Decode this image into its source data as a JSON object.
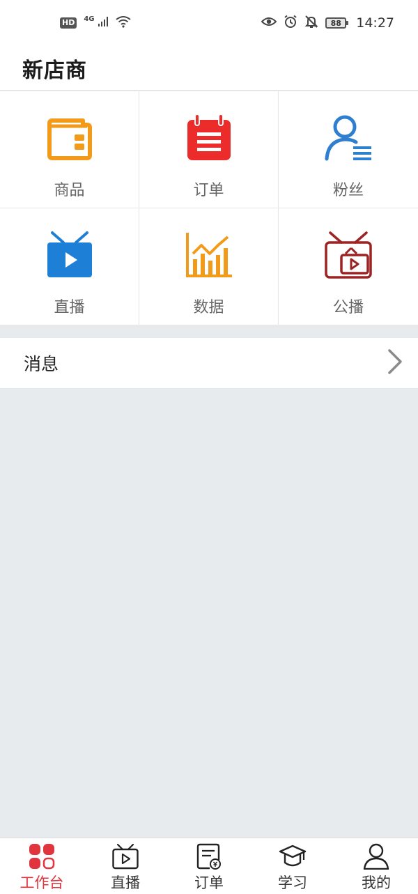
{
  "status_bar": {
    "hd": "HD",
    "network": "4G",
    "battery": "88",
    "time": "14:27",
    "icons": [
      "signal-icon",
      "wifi-icon",
      "eye-icon",
      "alarm-icon",
      "bell-off-icon",
      "battery-icon"
    ]
  },
  "header": {
    "title": "新店商"
  },
  "grid": {
    "items": [
      {
        "label": "商品",
        "icon": "wallet-icon",
        "color": "#f29a1a"
      },
      {
        "label": "订单",
        "icon": "notepad-icon",
        "color": "#ec2b2b"
      },
      {
        "label": "粉丝",
        "icon": "user-list-icon",
        "color": "#2f7fd0"
      },
      {
        "label": "直播",
        "icon": "tv-play-icon",
        "color": "#1e7fd6"
      },
      {
        "label": "数据",
        "icon": "bar-chart-icon",
        "color": "#f29a1a"
      },
      {
        "label": "公播",
        "icon": "tv-broadcast-icon",
        "color": "#9b2323"
      }
    ]
  },
  "message": {
    "label": "消息",
    "icon": "chevron-right-icon"
  },
  "tab_bar": {
    "active_color": "#e0343f",
    "items": [
      {
        "label": "工作台",
        "icon": "grid-apps-icon",
        "active": true
      },
      {
        "label": "直播",
        "icon": "tv-play-icon",
        "active": false
      },
      {
        "label": "订单",
        "icon": "document-money-icon",
        "active": false
      },
      {
        "label": "学习",
        "icon": "graduation-cap-icon",
        "active": false
      },
      {
        "label": "我的",
        "icon": "person-icon",
        "active": false
      }
    ]
  }
}
